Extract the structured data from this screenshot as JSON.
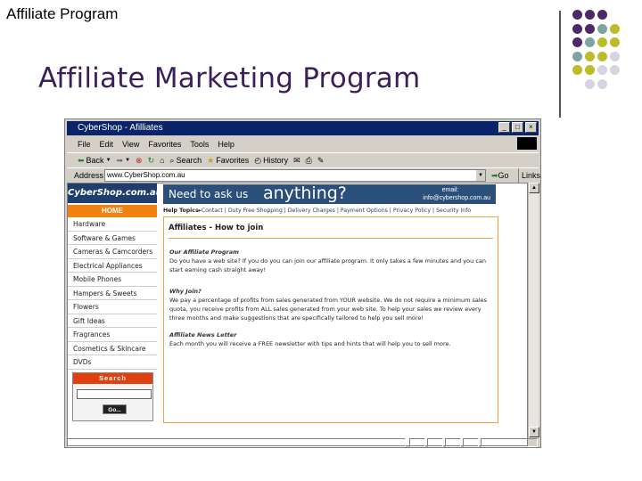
{
  "slide": {
    "label": "Affiliate Program",
    "title": "Affiliate Marketing Program",
    "dot_colors": {
      "purple": "#4b2a66",
      "teal": "#7ea3a0",
      "olive": "#bcbc2a",
      "lavender": "#d8d3e3"
    }
  },
  "window": {
    "title": "CyberShop - Afilliates",
    "controls": [
      "_",
      "□",
      "×"
    ],
    "menu": [
      "File",
      "Edit",
      "View",
      "Favorites",
      "Tools",
      "Help"
    ],
    "toolbar": {
      "back": "Back",
      "search": "Search",
      "favorites": "Favorites",
      "history": "History"
    },
    "address_label": "Address",
    "address_value": "www.CyberShop.com.au",
    "go_label": "Go",
    "links_label": "Links"
  },
  "site": {
    "logo": "CyberShop.com.au",
    "banner": {
      "lead": "Need to ask us",
      "big": "anything?",
      "email_label": "email:",
      "email": "info@cybershop.com.au"
    },
    "nav_home": "HOME",
    "nav_items": [
      "Hardware",
      "Software & Games",
      "Cameras & Camcorders",
      "Electrical Appliances",
      "Mobile Phones",
      "Hampers & Sweets",
      "Flowers",
      "Gift Ideas",
      "Fragrances",
      "Cosmetics & Skincare",
      "DVDs"
    ],
    "search": {
      "title": "Search",
      "button": "Go..."
    },
    "help_label": "Help Topics",
    "help_links": [
      "Contact",
      "Duty Free Shopping",
      "Delivery Charges",
      "Payment Options",
      "Privacy Policy",
      "Security Info"
    ],
    "heading": "Affiliates - How to join",
    "sections": [
      {
        "title": "Our Affiliate Program",
        "body": "Do you have a web site? If you do you can join our affiliate program. It only takes a few minutes and you can start earning cash straight away!"
      },
      {
        "title": "Why Join?",
        "body": "We pay a percentage of profits from sales generated from YOUR website. We do not require a minimum sales quota, you receive profits from ALL sales generated from your web site. To help your sales we review every three months and make suggestions that are specifically tailored to help you sell more!"
      },
      {
        "title": "Affiliate News Letter",
        "body": "Each month you will receive a FREE newsletter with tips and hints that will help you to sell more."
      }
    ]
  }
}
